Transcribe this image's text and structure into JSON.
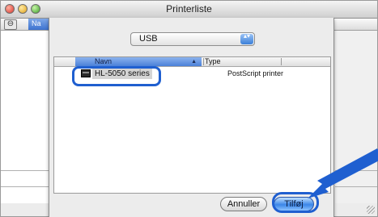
{
  "window": {
    "title": "Printerliste"
  },
  "background": {
    "tab_label": "Na",
    "minus_label": "⊖"
  },
  "sheet": {
    "popup": {
      "value": "USB",
      "arrows": "▴▾"
    },
    "list": {
      "columns": [
        {
          "label": "Navn",
          "sort": "▲"
        },
        {
          "label": "Type"
        }
      ],
      "rows": [
        {
          "name": "HL-5050 series",
          "type": "PostScript printer",
          "icon": "printer-icon",
          "selected": true
        }
      ]
    },
    "buttons": {
      "cancel": "Annuller",
      "add": "Tilføj"
    }
  },
  "annotations": {
    "highlight_color": "#1f5fd0",
    "arrow_color": "#1f5fd0"
  }
}
